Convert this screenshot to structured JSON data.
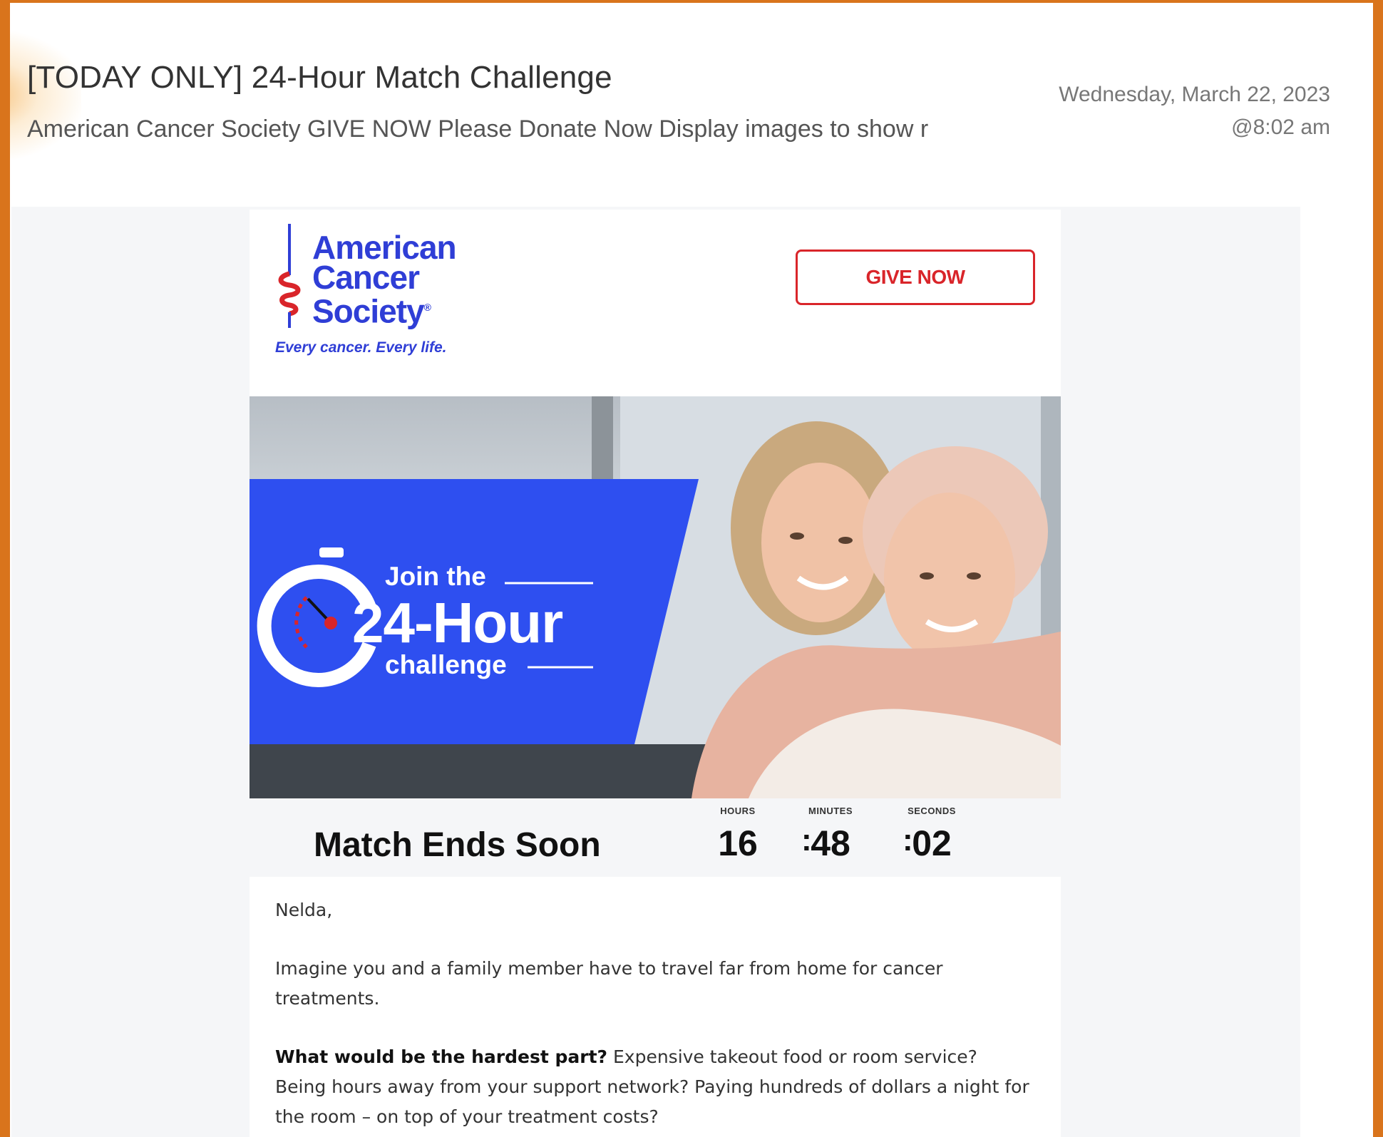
{
  "email": {
    "subject": "[TODAY ONLY] 24-Hour Match Challenge",
    "preview": "American Cancer Society GIVE NOW Please Donate Now Display images to show r",
    "date": "Wednesday, March 22, 2023",
    "time": "@8:02 am"
  },
  "header": {
    "logo_line1": "American",
    "logo_line2": "Cancer",
    "logo_line3": "Society",
    "logo_mark": "®",
    "tagline": "Every cancer. Every life.",
    "give_button": "GIVE NOW"
  },
  "hero": {
    "join": "Join the",
    "headline": "24-Hour",
    "challenge": "challenge"
  },
  "countdown": {
    "title": "Match Ends Soon",
    "hours_label": "HOURS",
    "minutes_label": "MINUTES",
    "seconds_label": "SECONDS",
    "hours": "16",
    "minutes": "48",
    "seconds": "02",
    "separator": ":"
  },
  "body": {
    "greeting": "Nelda,",
    "para1": "Imagine you and a family member have to travel far from home for cancer treatments.",
    "para2_bold": "What would be the hardest part?",
    "para2_rest": " Expensive takeout food or room service? Being hours away from your support network? Paying hundreds of dollars a night for the room – on top of your treatment costs?"
  },
  "colors": {
    "frame": "#d9741c",
    "brand_blue": "#2f3ed6",
    "give_red": "#d9252a",
    "hero_blue": "#2e4ff0"
  }
}
